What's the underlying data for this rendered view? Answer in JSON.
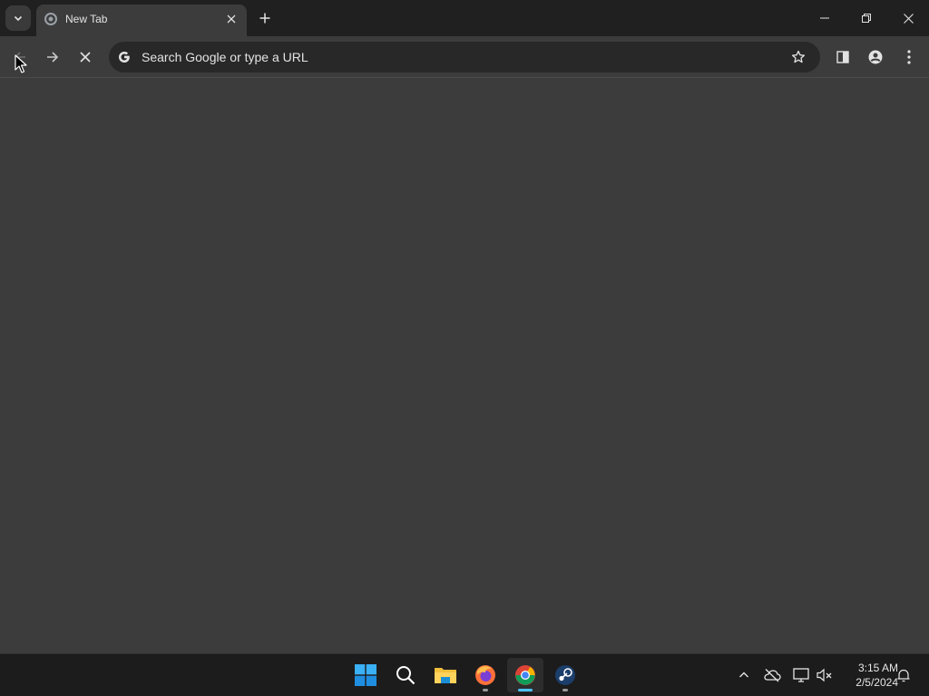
{
  "browser": {
    "tab": {
      "title": "New Tab"
    },
    "omnibox": {
      "placeholder": "Search Google or type a URL"
    }
  },
  "icons": {
    "tab_search": "chevron-down-icon",
    "tab_favicon": "loading-icon",
    "tab_close": "close-icon",
    "new_tab": "plus-icon",
    "minimize": "minimize-icon",
    "restore": "restore-icon",
    "close_window": "close-icon",
    "back": "arrow-left-icon",
    "forward": "arrow-right-icon",
    "stop": "stop-icon",
    "omnibox_engine": "google-g-icon",
    "bookmark": "star-icon",
    "side_panel": "side-panel-icon",
    "profile": "person-icon",
    "menu": "kebab-menu-icon"
  },
  "taskbar": {
    "apps": [
      "Start",
      "Search",
      "File Explorer",
      "Firefox",
      "Google Chrome",
      "Steam"
    ],
    "active_app": "Google Chrome"
  },
  "tray": {
    "time": "3:15 AM",
    "date": "2/5/2024"
  },
  "colors": {
    "titlebar": "#202020",
    "toolbar": "#3c3c3c",
    "omnibox": "#282828",
    "taskbar": "#1c1c1c",
    "accent": "#4cc2ff"
  }
}
